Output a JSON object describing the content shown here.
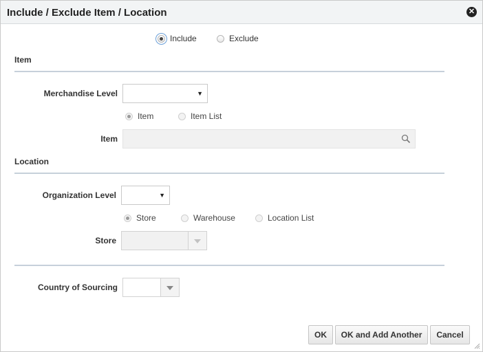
{
  "dialog": {
    "title": "Include / Exclude Item / Location"
  },
  "mode": {
    "include_label": "Include",
    "exclude_label": "Exclude",
    "selected": "Include"
  },
  "item_section": {
    "heading": "Item",
    "merchandise_level_label": "Merchandise Level",
    "merchandise_level_value": "",
    "type_options": [
      "Item",
      "Item List"
    ],
    "type_selected": "Item",
    "item_label": "Item",
    "item_value": ""
  },
  "location_section": {
    "heading": "Location",
    "organization_level_label": "Organization Level",
    "organization_level_value": "",
    "type_options": [
      "Store",
      "Warehouse",
      "Location List"
    ],
    "type_selected": "Store",
    "store_label": "Store",
    "store_value": ""
  },
  "sourcing": {
    "country_label": "Country of Sourcing",
    "country_value": ""
  },
  "buttons": {
    "ok": "OK",
    "ok_add_another": "OK and Add Another",
    "cancel": "Cancel"
  },
  "icons": {
    "close": "close-icon",
    "search": "search-icon",
    "dropdown": "dropdown-arrow-icon",
    "resize": "resize-grip-icon"
  },
  "colors": {
    "separator": "#c6d0da",
    "focus_ring": "#6a9fd8"
  }
}
